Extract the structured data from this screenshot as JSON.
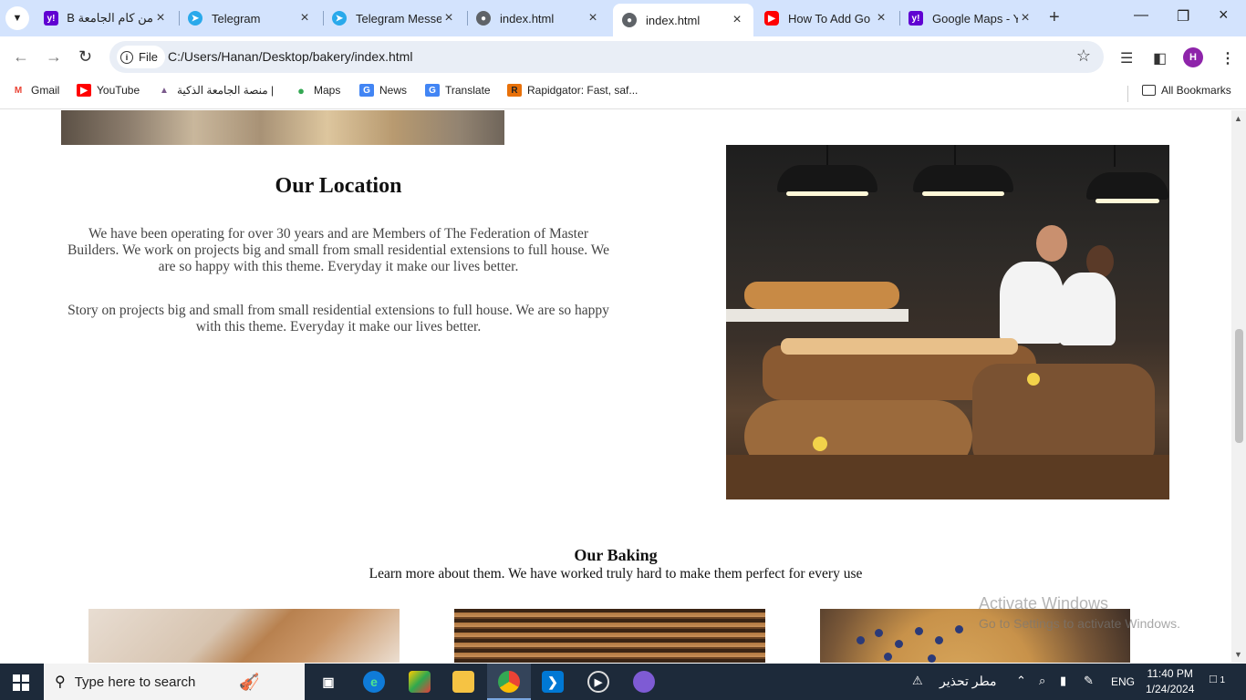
{
  "browser": {
    "tabs": [
      {
        "title": "من كام الجامعة B",
        "icon": "yahoo-icon",
        "active": false
      },
      {
        "title": "Telegram",
        "icon": "telegram-icon",
        "active": false
      },
      {
        "title": "Telegram Messe",
        "icon": "telegram-icon",
        "active": false
      },
      {
        "title": "index.html",
        "icon": "globe-icon",
        "active": false
      },
      {
        "title": "index.html",
        "icon": "globe-icon",
        "active": true
      },
      {
        "title": "How To Add Go",
        "icon": "youtube-icon",
        "active": false
      },
      {
        "title": "Google Maps - Y",
        "icon": "yahoo-icon",
        "active": false
      }
    ],
    "chip_label": "File",
    "url": "C:/Users/Hanan/Desktop/bakery/index.html",
    "profile_initial": "H",
    "bookmarks": [
      {
        "label": "Gmail",
        "icon": "gmail-icon"
      },
      {
        "label": "YouTube",
        "icon": "youtube-icon"
      },
      {
        "label": "منصة الجامعة الذكية |",
        "icon": "university-icon"
      },
      {
        "label": "Maps",
        "icon": "maps-icon"
      },
      {
        "label": "News",
        "icon": "news-icon"
      },
      {
        "label": "Translate",
        "icon": "translate-icon"
      },
      {
        "label": "Rapidgator: Fast, saf...",
        "icon": "rapidgator-icon"
      }
    ],
    "all_bookmarks_label": "All Bookmarks"
  },
  "page": {
    "location": {
      "title": "Our Location",
      "paragraph1": "We have been operating for over 30 years and are Members of The Federation of Master Builders. We work on projects big and small from small residential extensions to full house. We are so happy with this theme. Everyday it make our lives better.",
      "paragraph2": "Story on projects big and small from small residential extensions to full house. We are so happy with this theme. Everyday it make our lives better."
    },
    "baking": {
      "title": "Our Baking",
      "subtitle": "Learn more about them. We have worked truly hard to make them perfect for every use"
    }
  },
  "watermark": {
    "line1": "Activate Windows",
    "line2": "Go to Settings to activate Windows."
  },
  "taskbar": {
    "search_placeholder": "Type here to search",
    "weather": "مطر تحذير",
    "language": "ENG",
    "time": "11:40 PM",
    "date": "1/24/2024",
    "notifications": "1"
  },
  "colors": {
    "tabstrip": "#d3e3fd",
    "taskbar": "#1d2a3a",
    "youtube": "#ff0000",
    "yahoo": "#6001d2",
    "telegram": "#29a9eb",
    "vscode": "#0078d4"
  }
}
